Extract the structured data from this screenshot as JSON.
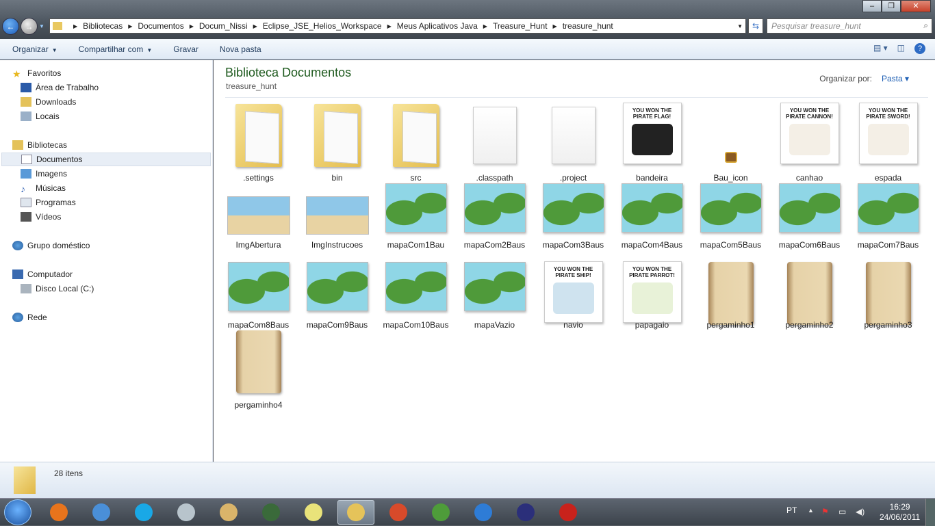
{
  "address": {
    "crumbs": [
      "Bibliotecas",
      "Documentos",
      "Docum_Nissi",
      "Eclipse_JSE_Helios_Workspace",
      "Meus Aplicativos Java",
      "Treasure_Hunt",
      "treasure_hunt"
    ],
    "search_placeholder": "Pesquisar treasure_hunt"
  },
  "toolbar": {
    "organize": "Organizar",
    "share": "Compartilhar com",
    "burn": "Gravar",
    "new_folder": "Nova pasta"
  },
  "nav": {
    "favorites": "Favoritos",
    "desktop": "Área de Trabalho",
    "downloads": "Downloads",
    "places": "Locais",
    "libraries": "Bibliotecas",
    "documents": "Documentos",
    "images": "Imagens",
    "music": "Músicas",
    "programs": "Programas",
    "videos": "Vídeos",
    "homegroup": "Grupo doméstico",
    "computer": "Computador",
    "local_disk": "Disco Local (C:)",
    "network": "Rede"
  },
  "content": {
    "title": "Biblioteca Documentos",
    "subtitle": "treasure_hunt",
    "arrange_label": "Organizar por:",
    "arrange_value": "Pasta",
    "items": [
      {
        "name": ".settings",
        "type": "folder"
      },
      {
        "name": "bin",
        "type": "folder"
      },
      {
        "name": "src",
        "type": "folder"
      },
      {
        "name": ".classpath",
        "type": "page"
      },
      {
        "name": ".project",
        "type": "page"
      },
      {
        "name": "bandeira",
        "type": "pirate",
        "caption": "YOU WON THE PIRATE FLAG!",
        "art": "#222222"
      },
      {
        "name": "Bau_icon",
        "type": "chest"
      },
      {
        "name": "canhao",
        "type": "pirate",
        "caption": "YOU WON THE PIRATE CANNON!",
        "art": "#f4efe6"
      },
      {
        "name": "espada",
        "type": "pirate",
        "caption": "YOU WON THE PIRATE SWORD!",
        "art": "#f4efe6"
      },
      {
        "name": "ImgAbertura",
        "type": "scene"
      },
      {
        "name": "ImgInstrucoes",
        "type": "scene"
      },
      {
        "name": "mapaCom1Bau",
        "type": "map"
      },
      {
        "name": "mapaCom2Baus",
        "type": "map"
      },
      {
        "name": "mapaCom3Baus",
        "type": "map"
      },
      {
        "name": "mapaCom4Baus",
        "type": "map"
      },
      {
        "name": "mapaCom5Baus",
        "type": "map"
      },
      {
        "name": "mapaCom6Baus",
        "type": "map"
      },
      {
        "name": "mapaCom7Baus",
        "type": "map"
      },
      {
        "name": "mapaCom8Baus",
        "type": "map"
      },
      {
        "name": "mapaCom9Baus",
        "type": "map"
      },
      {
        "name": "mapaCom10Baus",
        "type": "map"
      },
      {
        "name": "mapaVazio",
        "type": "map"
      },
      {
        "name": "navio",
        "type": "pirate",
        "caption": "YOU WON THE PIRATE SHIP!",
        "art": "#cfe3ef"
      },
      {
        "name": "papagaio",
        "type": "pirate",
        "caption": "YOU WON THE PIRATE PARROT!",
        "art": "#e8f2d8"
      },
      {
        "name": "pergaminho1",
        "type": "scroll"
      },
      {
        "name": "pergaminho2",
        "type": "scroll"
      },
      {
        "name": "pergaminho3",
        "type": "scroll"
      },
      {
        "name": "pergaminho4",
        "type": "scroll"
      }
    ]
  },
  "status": {
    "count": "28 itens"
  },
  "taskbar": {
    "apps": [
      {
        "name": "firefox",
        "color": "#e8741c"
      },
      {
        "name": "itunes",
        "color": "#4a8fd8"
      },
      {
        "name": "skype",
        "color": "#19a8e6"
      },
      {
        "name": "calculator",
        "color": "#b8c4cc"
      },
      {
        "name": "paint",
        "color": "#d9b46a"
      },
      {
        "name": "terminal",
        "color": "#3a6a3a"
      },
      {
        "name": "sticky-notes",
        "color": "#e9e37a"
      },
      {
        "name": "windows-explorer",
        "color": "#e5c35a",
        "active": true
      },
      {
        "name": "globe",
        "color": "#d84a2a"
      },
      {
        "name": "gecko",
        "color": "#4e9c3a"
      },
      {
        "name": "internet-explorer",
        "color": "#2e7cd6"
      },
      {
        "name": "eclipse",
        "color": "#2b2f7a"
      },
      {
        "name": "adobe-reader",
        "color": "#c8221c"
      }
    ],
    "lang": "PT",
    "time": "16:29",
    "date": "24/06/2011"
  }
}
